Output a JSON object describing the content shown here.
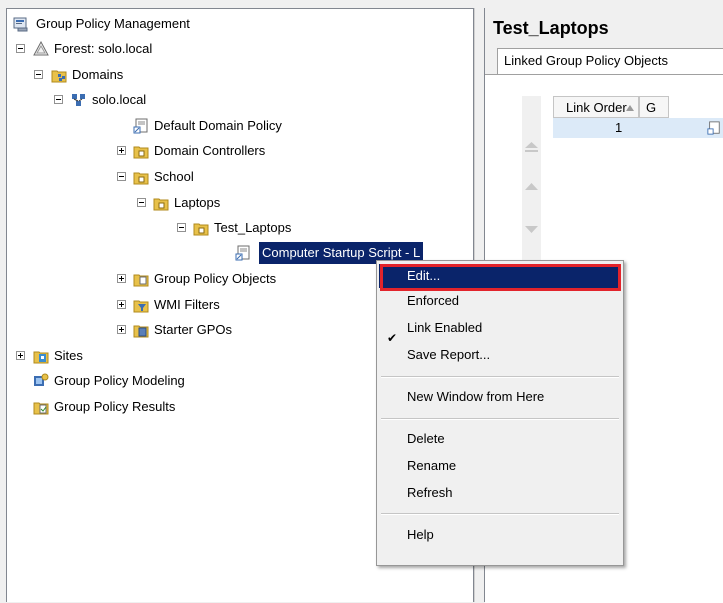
{
  "tree": {
    "root": "Group Policy Management",
    "forest": "Forest: solo.local",
    "domains": "Domains",
    "domain": "solo.local",
    "default_policy": "Default Domain Policy",
    "domain_controllers": "Domain Controllers",
    "school": "School",
    "laptops": "Laptops",
    "test_laptops": "Test_Laptops",
    "selected_gpo": "Computer Startup Script - L",
    "gpo_objects": "Group Policy Objects",
    "wmi_filters": "WMI Filters",
    "starter_gpos": "Starter GPOs",
    "sites": "Sites",
    "modeling": "Group Policy Modeling",
    "results": "Group Policy Results"
  },
  "details": {
    "title": "Test_Laptops",
    "tab": "Linked Group Policy Objects",
    "col_link_order": "Link Order",
    "col_gpo": "G",
    "row1_order": "1"
  },
  "context_menu": {
    "edit": "Edit...",
    "enforced": "Enforced",
    "link_enabled": "Link Enabled",
    "save_report": "Save Report...",
    "new_window": "New Window from Here",
    "delete": "Delete",
    "rename": "Rename",
    "refresh": "Refresh",
    "help": "Help"
  },
  "colors": {
    "selection": "#0a246a",
    "highlight_box": "#e2242b",
    "folder": "#e8c14a"
  }
}
